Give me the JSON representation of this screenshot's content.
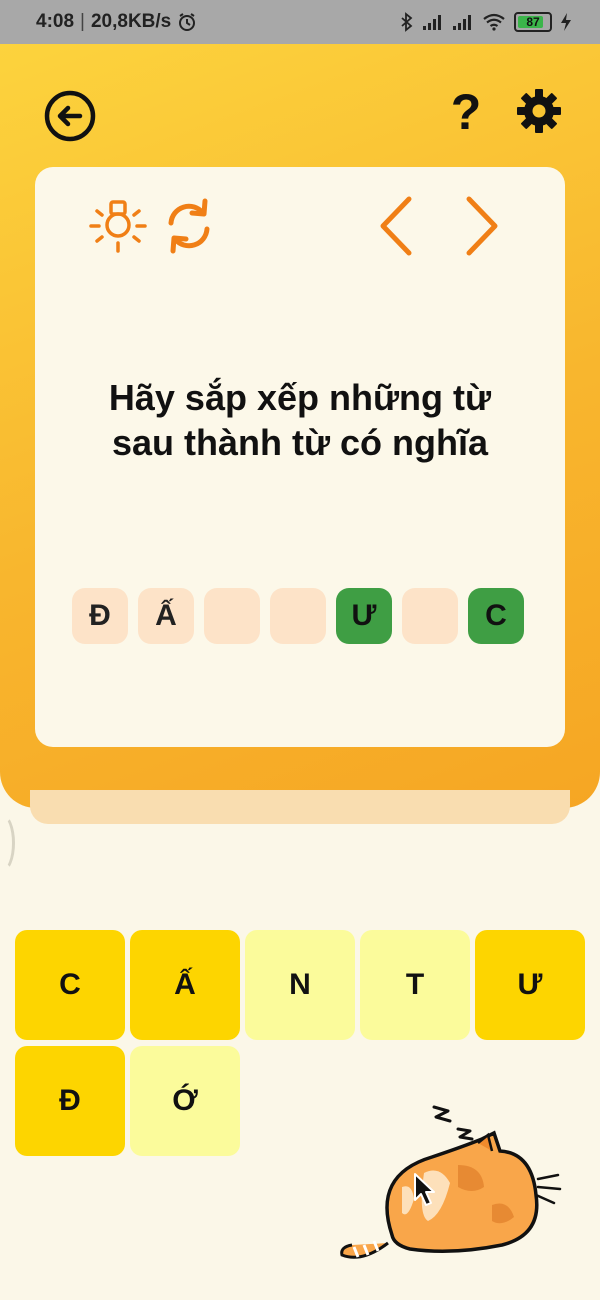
{
  "status_bar": {
    "time": "4:08",
    "speed": "20,8KB/s",
    "battery": "87",
    "icons": [
      "alarm-icon",
      "bluetooth-icon",
      "signal-icon",
      "signal-icon",
      "wifi-icon",
      "battery-icon",
      "charging-icon"
    ]
  },
  "header": {
    "back_icon": "back-arrow-circle-icon",
    "help_label": "?",
    "settings_icon": "gear-icon"
  },
  "card": {
    "icons": [
      "hint-bulb-icon",
      "refresh-icon",
      "previous-icon",
      "next-icon"
    ],
    "question": "Hãy sắp xếp những từ sau thành từ có nghĩa",
    "slots": [
      {
        "letter": "Đ",
        "state": "filled"
      },
      {
        "letter": "Ấ",
        "state": "filled"
      },
      {
        "letter": "",
        "state": "empty"
      },
      {
        "letter": "",
        "state": "empty"
      },
      {
        "letter": "Ư",
        "state": "correct"
      },
      {
        "letter": "",
        "state": "empty"
      },
      {
        "letter": "C",
        "state": "correct"
      }
    ]
  },
  "letter_tiles": [
    {
      "letter": "C",
      "style": "dark"
    },
    {
      "letter": "Ấ",
      "style": "dark"
    },
    {
      "letter": "N",
      "style": "light"
    },
    {
      "letter": "T",
      "style": "light"
    },
    {
      "letter": "Ư",
      "style": "dark"
    },
    {
      "letter": "Đ",
      "style": "dark"
    },
    {
      "letter": "Ớ",
      "style": "light"
    }
  ],
  "colors": {
    "accent_orange": "#f07f16",
    "header_yellow": "#fcd33d",
    "slot_empty": "#fde3c8",
    "slot_correct": "#3f9e44",
    "tile_dark": "#fdd500",
    "tile_light": "#fbfb9b",
    "background": "#fbf7e8"
  }
}
